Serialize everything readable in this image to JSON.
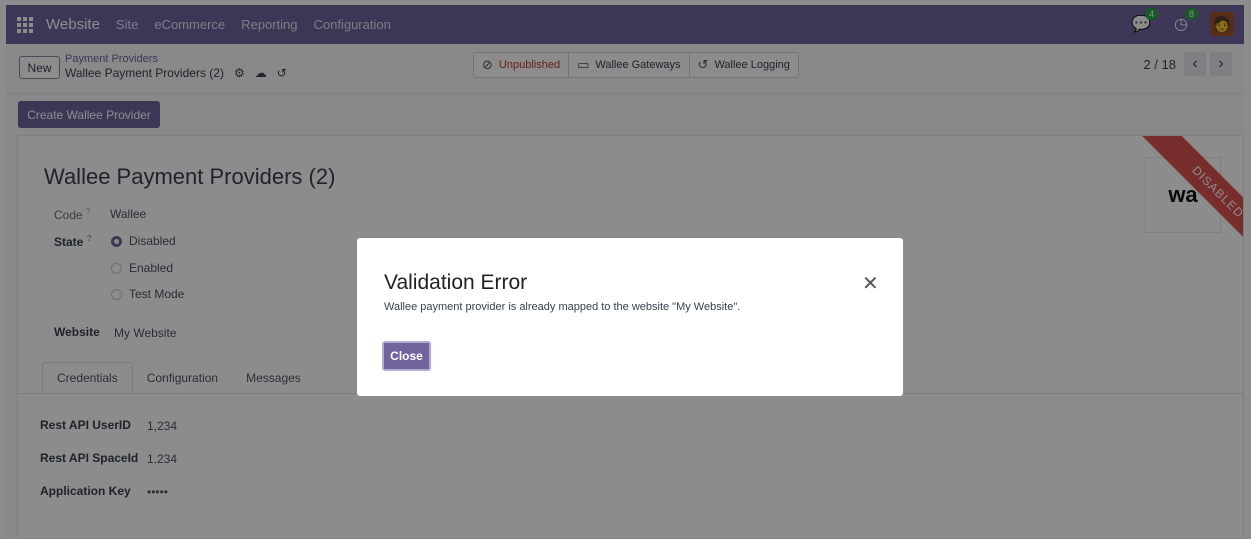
{
  "navbar": {
    "brand": "Website",
    "menus": [
      "Site",
      "eCommerce",
      "Reporting",
      "Configuration"
    ],
    "messages_badge": "4",
    "activity_badge": "8"
  },
  "control_panel": {
    "new_label": "New",
    "breadcrumb_parent": "Payment Providers",
    "breadcrumb_current": "Wallee Payment Providers (2)",
    "stat_buttons": [
      "Unpublished",
      "Wallee Gateways",
      "Wallee Logging"
    ],
    "pager_value": "2 / 18"
  },
  "create_button_label": "Create Wallee Provider",
  "form": {
    "title": "Wallee Payment Providers (2)",
    "code_label": "Code",
    "code_value": "Wallee",
    "state_label": "State",
    "state_options": [
      "Disabled",
      "Enabled",
      "Test Mode"
    ],
    "state_selected": "Disabled",
    "website_label": "Website",
    "website_value": "My Website",
    "tabs": [
      "Credentials",
      "Configuration",
      "Messages"
    ],
    "active_tab": "Credentials",
    "fields": [
      {
        "label": "Rest API UserID",
        "value": "1,234"
      },
      {
        "label": "Rest API SpaceId",
        "value": "1,234"
      },
      {
        "label": "Application Key",
        "value": "•••••"
      }
    ],
    "logo_text": "wa",
    "ribbon_text": "DISABLED",
    "help_mark": "?"
  },
  "dialog": {
    "title": "Validation Error",
    "message": "Wallee payment provider is already mapped to the website \"My Website\".",
    "close_button": "Close"
  },
  "colors": {
    "brand": "#71639e",
    "ribbon": "#d9534f",
    "badge": "#28a745"
  }
}
